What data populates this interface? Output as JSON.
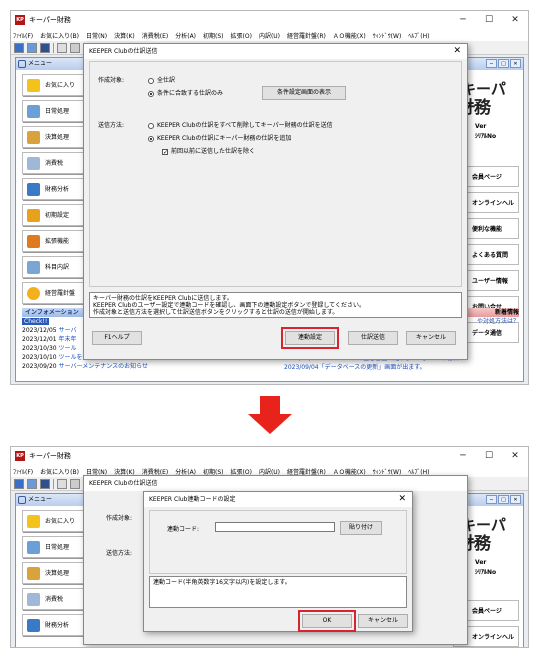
{
  "app": {
    "title": "キーパー財務",
    "menus": [
      "ﾌｧｲﾙ(F)",
      "お気に入り(B)",
      "日常(N)",
      "決算(K)",
      "消費税(E)",
      "分析(A)",
      "初期(S)",
      "拡張(O)",
      "内訳(U)",
      "経営羅針盤(R)",
      "ＡＯ機能(X)",
      "ｳｨﾝﾄﾞｳ(W)",
      "ﾍﾙﾌﾟ(H)"
    ]
  },
  "menu_window": {
    "title": "メニュー",
    "left_items": [
      "お気に入り",
      "日常処理",
      "決算処理",
      "消費税",
      "財務分析",
      "初期設定",
      "拡張機能",
      "科目内訳",
      "経営羅針盤"
    ],
    "logo_line1": "キーパー",
    "logo_line2": "財務",
    "ver": "Ver",
    "serial": "ｼﾘｱﾙNo",
    "right_items": [
      "会員ページ",
      "オンラインヘルプ",
      "便利な機能",
      "よくある質問",
      "ユーザー情報",
      "お問い合せ",
      "データ通信"
    ],
    "news_header": "新着情報",
    "news_q": "や対処方法は？",
    "news": [
      "2023/09/04「AOｷｰｽﾃｰｼｮﾝの空き容量が足りません」という警告が",
      "2023/09/04「データベースの更新」画面が出ます。"
    ]
  },
  "info": {
    "header": "インフォメーション",
    "check_badge": "Check!!",
    "rows": [
      [
        "2023/12/05",
        "サーバ"
      ],
      [
        "2023/12/01",
        "年末年"
      ],
      [
        "2023/10/30",
        "ツール"
      ],
      [
        "2023/10/10",
        "ツールを更新しました"
      ],
      [
        "2023/09/20",
        "サーバーメンテナンスのお知らせ"
      ]
    ]
  },
  "dialog1": {
    "title": "KEEPER Clubの仕訳送信",
    "target_label": "作成対象:",
    "opt_all": "全仕訳",
    "opt_match": "条件に合致する仕訳のみ",
    "cond_button": "条件設定画面の表示",
    "method_label": "送信方法:",
    "opt_delete_all": "KEEPER Clubの仕訳をすべて削除してキーパー財務の仕訳を送信",
    "opt_append": "KEEPER Clubの仕訳にキーパー財務の仕訳を追加",
    "chk_exclude": "前回以前に送信した仕訳を除く",
    "message": [
      "キーパー財務の仕訳をKEEPER Clubに送信します。",
      "KEEPER Clubのユーザー設定で連動コードを確認し、画面下の連動設定ボタンで登録してください。",
      "作成対象と送信方法を選択して仕訳送信ボタンをクリックすると仕訳の送信が開始します。"
    ],
    "help": "F1ヘルプ",
    "link_setting": "連動設定",
    "send": "仕訳送信",
    "cancel": "キャンセル"
  },
  "dialog2": {
    "title": "KEEPER Club連動コードの設定",
    "code_label": "連動コード:",
    "code_value": "",
    "paste": "貼り付け",
    "message": "連動コード(半角英数字16文字以内)を設定します。",
    "ok": "OK",
    "cancel": "キャンセル"
  },
  "colors": {
    "highlight": "#d9232d",
    "arrow": "#e8231b"
  }
}
